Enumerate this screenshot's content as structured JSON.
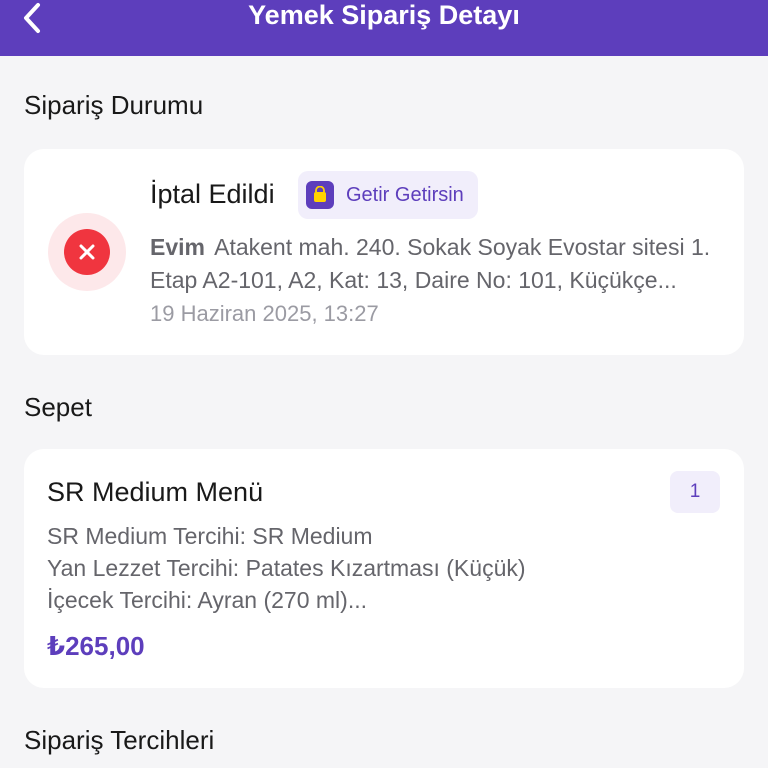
{
  "header": {
    "title": "Yemek Sipariş Detayı",
    "back_icon": "chevron-left-icon"
  },
  "status_section": {
    "title": "Sipariş Durumu",
    "status": "İptal Edildi",
    "status_icon": "close-circle-icon",
    "brand": "Getir Getirsin",
    "brand_icon": "shopping-bag-icon",
    "address_label": "Evim",
    "address": "Atakent mah. 240. Sokak Soyak Evostar sitesi 1. Etap A2-101, A2, Kat: 13, Daire No: 101, Küçükçe...",
    "date": "19 Haziran 2025, 13:27"
  },
  "cart_section": {
    "title": "Sepet",
    "item": {
      "name": "SR Medium Menü",
      "quantity": "1",
      "options": [
        "SR Medium Tercihi: SR Medium",
        "Yan Lezzet Tercihi: Patates Kızartması (Küçük)",
        "İçecek Tercihi: Ayran (270 ml)..."
      ],
      "price": "₺265,00"
    }
  },
  "preferences_section": {
    "title": "Sipariş Tercihleri"
  },
  "colors": {
    "brand": "#5d3ebc",
    "cancel_red": "#f0353f",
    "background": "#f5f5f7"
  }
}
